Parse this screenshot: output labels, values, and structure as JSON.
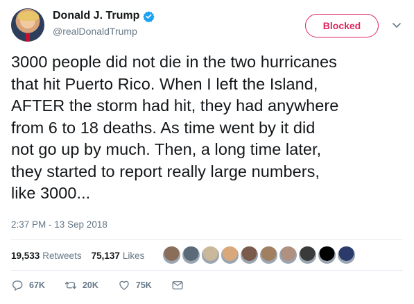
{
  "tweet": {
    "author": {
      "display_name": "Donald J. Trump",
      "handle": "@realDonaldTrump",
      "verified": true
    },
    "follow_state_label": "Blocked",
    "text": "3000 people did not die in the two hurricanes\nthat hit Puerto Rico. When I left the Island,\nAFTER the storm had hit, they had anywhere\nfrom 6 to 18 deaths. As time went by it did\nnot go up by much. Then, a long time later,\nthey started to report really large numbers,\nlike 3000...",
    "timestamp": "2:37 PM - 13 Sep 2018",
    "stats": {
      "retweets_count": "19,533",
      "retweets_label": "Retweets",
      "likes_count": "75,137",
      "likes_label": "Likes"
    },
    "actions": {
      "replies": "67K",
      "retweets": "20K",
      "likes": "75K"
    }
  },
  "colors": {
    "accent": "#1da1f2",
    "blocked": "#e0245e",
    "secondary_text": "#657786"
  },
  "likers": [
    "#8a6e5a",
    "#5b6a78",
    "#c9b89a",
    "#d9a87a",
    "#7a5a4a",
    "#a08060",
    "#b09080",
    "#3a3a3a",
    "#000000",
    "#2a3a6a"
  ]
}
